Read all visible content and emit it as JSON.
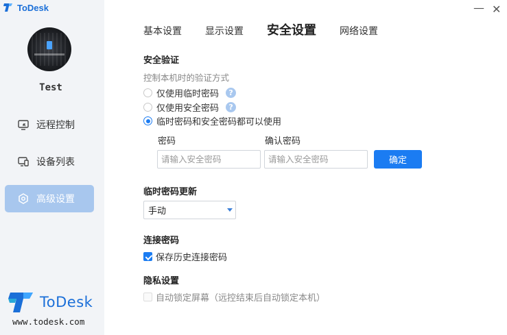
{
  "app": {
    "title": "ToDesk",
    "brand_name": "ToDesk",
    "url": "www.todesk.com",
    "accent": "#1b7cf2"
  },
  "window": {
    "minimize_glyph": "—",
    "close_glyph": "✕"
  },
  "user": {
    "name": "Test"
  },
  "sidebar": {
    "items": [
      {
        "label": "远程控制",
        "icon": "remote-control-icon",
        "active": false
      },
      {
        "label": "设备列表",
        "icon": "device-list-icon",
        "active": false
      },
      {
        "label": "高级设置",
        "icon": "settings-icon",
        "active": true
      }
    ]
  },
  "tabs": [
    {
      "label": "基本设置",
      "active": false
    },
    {
      "label": "显示设置",
      "active": false
    },
    {
      "label": "安全设置",
      "active": true
    },
    {
      "label": "网络设置",
      "active": false
    }
  ],
  "security": {
    "title": "安全验证",
    "hint": "控制本机时的验证方式",
    "options": [
      {
        "label": "仅使用临时密码",
        "checked": false,
        "help": true
      },
      {
        "label": "仅使用安全密码",
        "checked": false,
        "help": true
      },
      {
        "label": "临时密码和安全密码都可以使用",
        "checked": true,
        "help": false
      }
    ],
    "help_glyph": "?",
    "password_label": "密码",
    "password_placeholder": "请输入安全密码",
    "confirm_label": "确认密码",
    "confirm_placeholder": "请输入安全密码",
    "confirm_button": "确定"
  },
  "temp_password": {
    "title": "临时密码更新",
    "selected": "手动"
  },
  "connect_password": {
    "title": "连接密码",
    "save_history_label": "保存历史连接密码",
    "save_history_checked": true
  },
  "privacy": {
    "title": "隐私设置",
    "auto_lock_label": "自动锁定屏幕（远控结束后自动锁定本机）",
    "auto_lock_checked": false
  }
}
